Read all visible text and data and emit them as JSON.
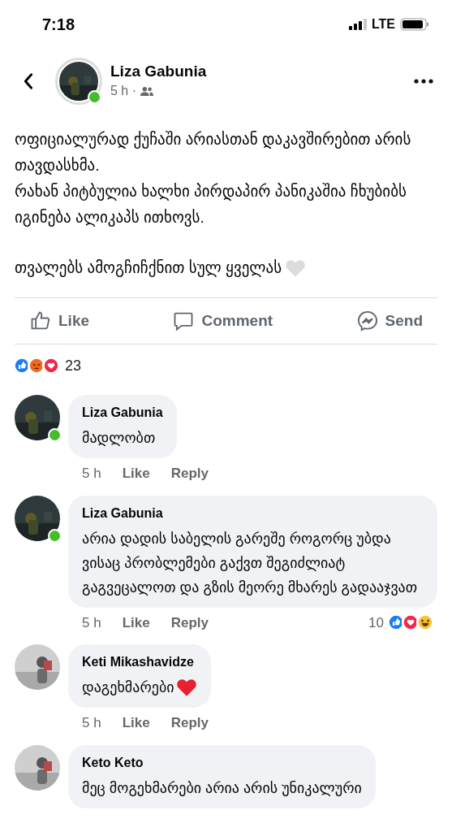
{
  "status_bar": {
    "time": "7:18",
    "network": "LTE"
  },
  "post": {
    "author": "Liza Gabunia",
    "online": true,
    "time": "5 h ·",
    "paragraphs": [
      {
        "text": "ოფიციალურად ქუჩაში არიასთან დაკავშირებით არის თავდასხმა.\nრახან პიტბულია ხალხი პირდაპირ პანიკაშია ჩხუბიბს იგინება ალიკაპს ითხოვს."
      },
      {
        "text": "თვალებს ამოგჩიჩქნით სულ ყველას",
        "heart": {
          "color": "#dcdcdc"
        }
      }
    ],
    "actions": [
      {
        "kind": "like",
        "label": "Like"
      },
      {
        "kind": "comment",
        "label": "Comment"
      },
      {
        "kind": "send",
        "label": "Send"
      }
    ],
    "reactions": [
      {
        "kind": "like"
      },
      {
        "kind": "angry"
      },
      {
        "kind": "love"
      }
    ],
    "reaction_count": "23"
  },
  "comments": [
    {
      "author": "Liza Gabunia",
      "online": true,
      "text": "მადლობთ",
      "time": "5 h",
      "like": "Like",
      "reply": "Reply"
    },
    {
      "author": "Liza Gabunia",
      "online": true,
      "text": "არია დადის საბელის გარეშე როგორც უბდა ვისაც პრობლემები გაქვთ შეგიძლიატ გაგვეცალოთ და გზის მეორე მხარეს გადააჯვათ",
      "time": "5 h",
      "like": "Like",
      "reply": "Reply",
      "reaction_count": "10",
      "reactions": [
        {
          "kind": "like"
        },
        {
          "kind": "love"
        },
        {
          "kind": "haha"
        }
      ]
    },
    {
      "author": "Keti Mikashavidze",
      "online": false,
      "text": "დაგეხმარები",
      "heart": {
        "color": "#e8202f"
      },
      "time": "5 h",
      "like": "Like",
      "reply": "Reply"
    },
    {
      "author": "Keto Keto",
      "online": false,
      "text": "მეც მოგეხმარები არია არის უნიკალური"
    }
  ]
}
